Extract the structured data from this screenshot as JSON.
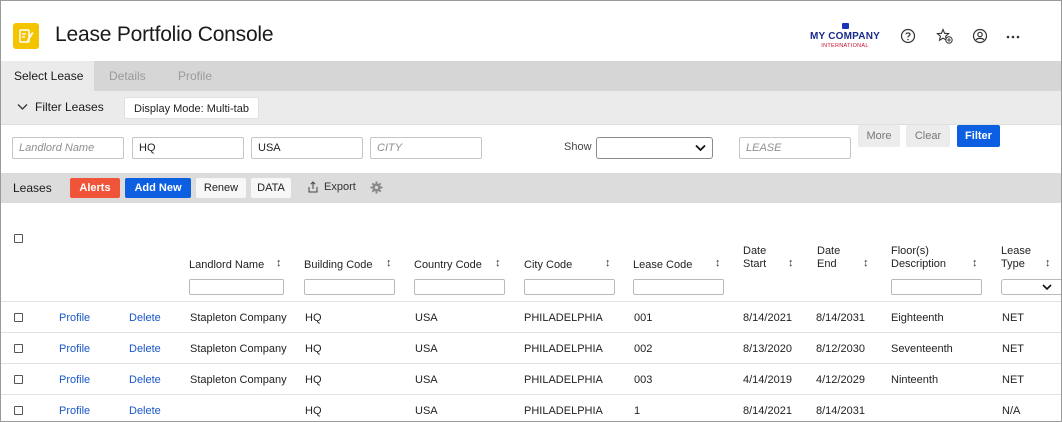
{
  "header": {
    "app_icon": "edit-document-icon",
    "title": "Lease Portfolio Console",
    "logo": {
      "line1": "MY COMPANY",
      "line2": "INTERNATIONAL"
    },
    "icons": [
      "help-icon",
      "favorites-icon",
      "account-icon",
      "more-icon"
    ]
  },
  "tabs": [
    {
      "label": "Select Lease",
      "active": true
    },
    {
      "label": "Details",
      "active": false
    },
    {
      "label": "Profile",
      "active": false
    }
  ],
  "filter_bar": {
    "toggle_label": "Filter Leases",
    "display_mode_label": "Display Mode: Multi-tab"
  },
  "filters": {
    "landlord": {
      "placeholder": "Landlord Name",
      "value": ""
    },
    "building": {
      "value": "HQ"
    },
    "country": {
      "value": "USA"
    },
    "city": {
      "placeholder": "CITY",
      "value": ""
    },
    "show_label": "Show",
    "show_value": "",
    "lease": {
      "placeholder": "LEASE",
      "value": ""
    },
    "more_label": "More",
    "clear_label": "Clear",
    "filter_label": "Filter"
  },
  "toolbar": {
    "title": "Leases",
    "alerts_label": "Alerts",
    "add_new_label": "Add New",
    "renew_label": "Renew",
    "data_label": "DATA",
    "export_label": "Export"
  },
  "table": {
    "columns": {
      "landlord": "Landlord Name",
      "building": "Building Code",
      "country": "Country Code",
      "city": "City Code",
      "lease": "Lease Code",
      "date_start_1": "Date",
      "date_start_2": "Start",
      "date_end_1": "Date",
      "date_end_2": "End",
      "floor_1": "Floor(s)",
      "floor_2": "Description",
      "type_1": "Lease",
      "type_2": "Type"
    },
    "row_actions": {
      "profile": "Profile",
      "delete": "Delete"
    },
    "rows": [
      {
        "landlord": "Stapleton Company",
        "building": "HQ",
        "country": "USA",
        "city": "PHILADELPHIA",
        "lease": "001",
        "start": "8/14/2021",
        "end": "8/14/2031",
        "floor": "Eighteenth",
        "type": "NET"
      },
      {
        "landlord": "Stapleton Company",
        "building": "HQ",
        "country": "USA",
        "city": "PHILADELPHIA",
        "lease": "002",
        "start": "8/13/2020",
        "end": "8/12/2030",
        "floor": "Seventeenth",
        "type": "NET"
      },
      {
        "landlord": "Stapleton Company",
        "building": "HQ",
        "country": "USA",
        "city": "PHILADELPHIA",
        "lease": "003",
        "start": "4/14/2019",
        "end": "4/12/2029",
        "floor": "Ninteenth",
        "type": "NET"
      },
      {
        "landlord": "",
        "building": "HQ",
        "country": "USA",
        "city": "PHILADELPHIA",
        "lease": "1",
        "start": "8/14/2021",
        "end": "8/14/2031",
        "floor": "",
        "type": "N/A"
      }
    ]
  }
}
